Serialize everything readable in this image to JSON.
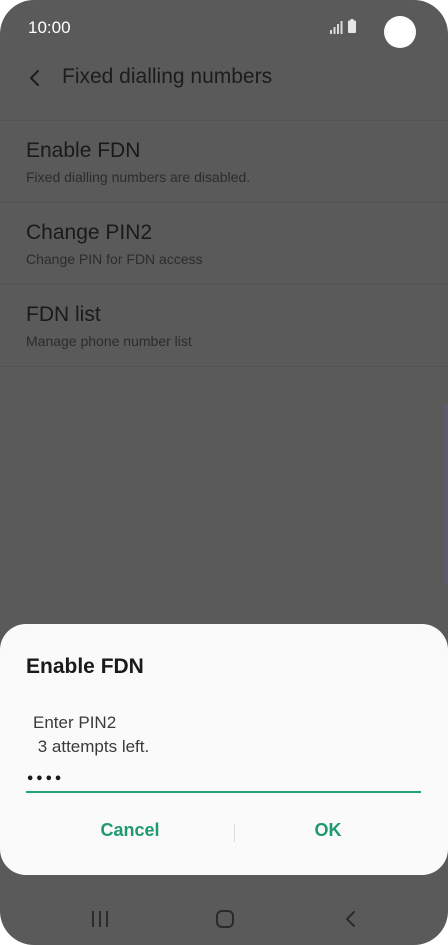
{
  "status_bar": {
    "time": "10:00",
    "icons": [
      "signal-icon",
      "battery-icon"
    ]
  },
  "app_bar": {
    "title": "Fixed dialling numbers",
    "back_icon": "chevron-left-icon"
  },
  "settings": {
    "items": [
      {
        "title": "Enable FDN",
        "subtitle": "Fixed dialling numbers are disabled."
      },
      {
        "title": "Change PIN2",
        "subtitle": "Change PIN for FDN access"
      },
      {
        "title": "FDN list",
        "subtitle": "Manage phone number list"
      }
    ]
  },
  "dialog": {
    "title": "Enable FDN",
    "message_line1": "Enter PIN2",
    "message_line2": " 3 attempts left.",
    "pin_value": "••••",
    "cancel_label": "Cancel",
    "ok_label": "OK",
    "accent_color": "#21a47a"
  },
  "nav_bar": {
    "icons": [
      "recents-icon",
      "home-icon",
      "back-icon"
    ]
  }
}
